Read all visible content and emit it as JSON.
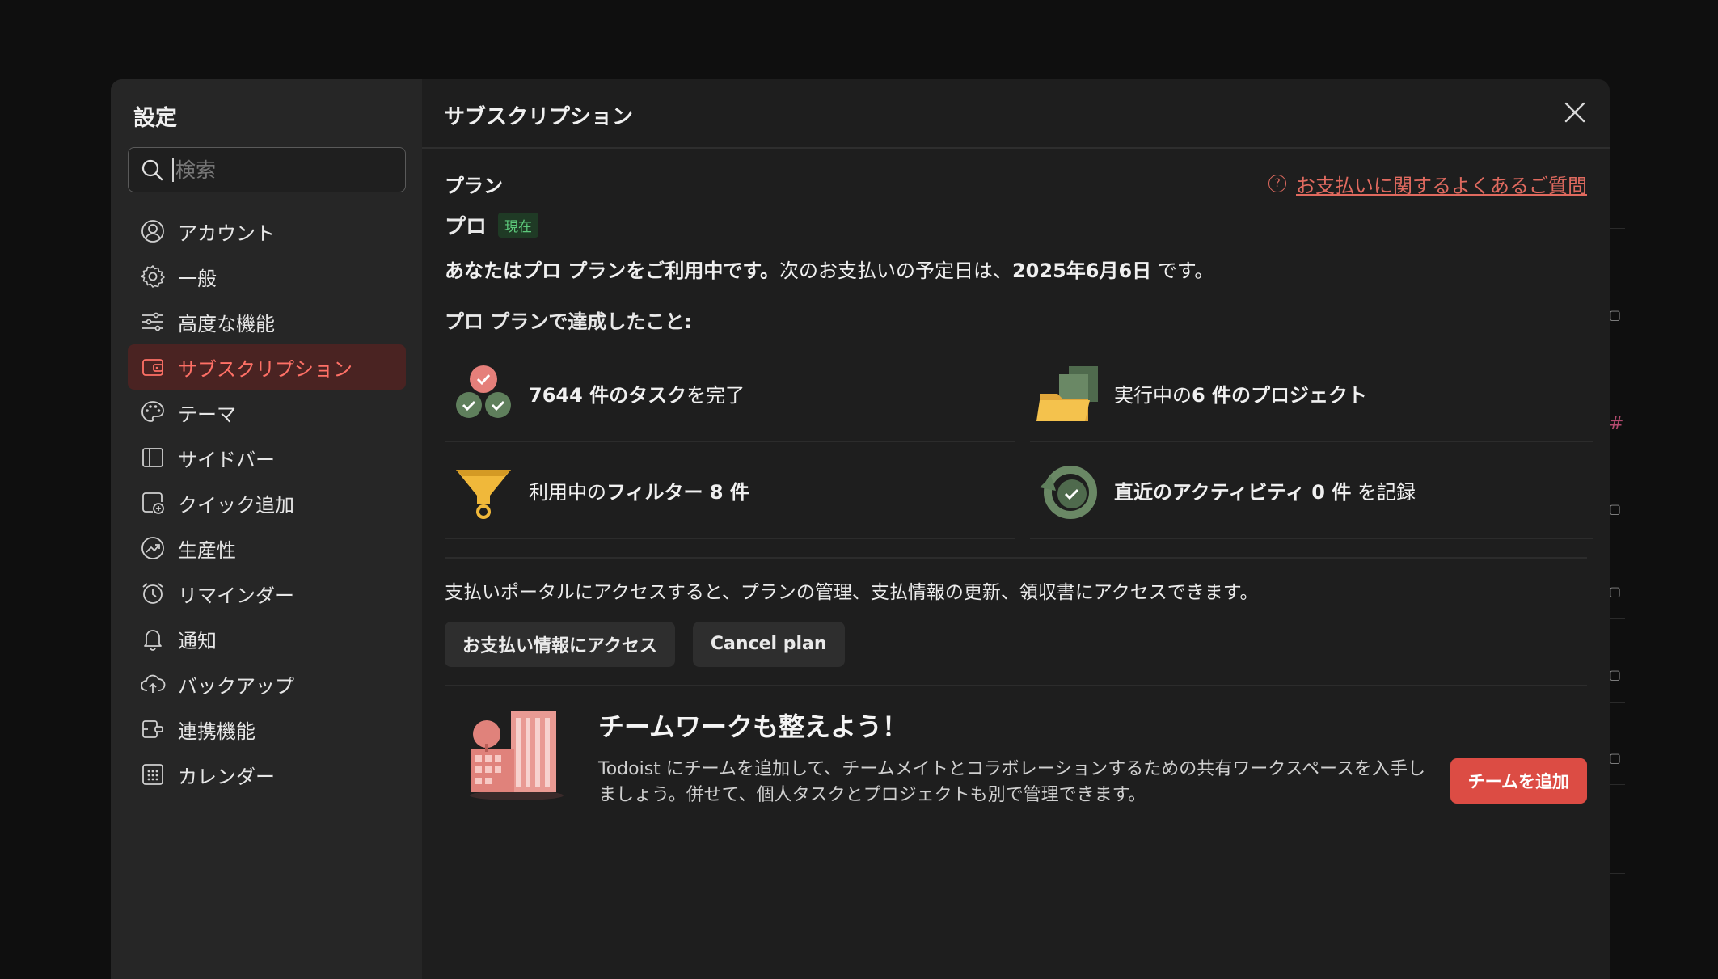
{
  "sidebar": {
    "title": "設定",
    "search_placeholder": "検索",
    "items": [
      {
        "label": "アカウント",
        "icon": "account-icon"
      },
      {
        "label": "一般",
        "icon": "gear-icon"
      },
      {
        "label": "高度な機能",
        "icon": "sliders-icon"
      },
      {
        "label": "サブスクリプション",
        "icon": "wallet-icon",
        "active": true
      },
      {
        "label": "テーマ",
        "icon": "palette-icon"
      },
      {
        "label": "サイドバー",
        "icon": "sidebar-icon"
      },
      {
        "label": "クイック追加",
        "icon": "quick-add-icon"
      },
      {
        "label": "生産性",
        "icon": "productivity-icon"
      },
      {
        "label": "リマインダー",
        "icon": "alarm-icon"
      },
      {
        "label": "通知",
        "icon": "bell-icon"
      },
      {
        "label": "バックアップ",
        "icon": "cloud-upload-icon"
      },
      {
        "label": "連携機能",
        "icon": "integrations-icon"
      },
      {
        "label": "カレンダー",
        "icon": "calendar-icon"
      }
    ]
  },
  "main": {
    "title": "サブスクリプション",
    "plan_label": "プラン",
    "faq_link": "お支払いに関するよくあるご質問",
    "plan_name": "プロ",
    "plan_badge": "現在",
    "plan_desc_a": "あなたはプロ プランをご利用中です。",
    "plan_desc_b": "次のお支払いの予定日は、",
    "plan_desc_date": "2025年6月6日",
    "plan_desc_c": " です。",
    "achieved_title": "プロ プランで達成したこと:",
    "stats": {
      "tasks_bold": "7644 件のタスク",
      "tasks_rest": "を完了",
      "projects_pre": "実行中の",
      "projects_bold": "6 件のプロジェクト",
      "filters_pre": "利用中の",
      "filters_bold": "フィルター 8 件",
      "activity_bold": "直近のアクティビティ 0 件",
      "activity_rest": " を記録"
    },
    "portal_text": "支払いポータルにアクセスすると、プランの管理、支払情報の更新、領収書にアクセスできます。",
    "billing_button": "お支払い情報にアクセス",
    "cancel_button": "Cancel plan",
    "team_title": "チームワークも整えよう！",
    "team_desc": "Todoist にチームを追加して、チームメイトとコラボレーションするための共有ワークスペースを入手しましょう。併せて、個人タスクとプロジェクトも別で管理できます。",
    "team_button": "チームを追加"
  },
  "colors": {
    "accent": "#dc4c44",
    "active_bg": "#4a2322",
    "active_text": "#ff7066",
    "badge_text": "#5cc77a"
  }
}
